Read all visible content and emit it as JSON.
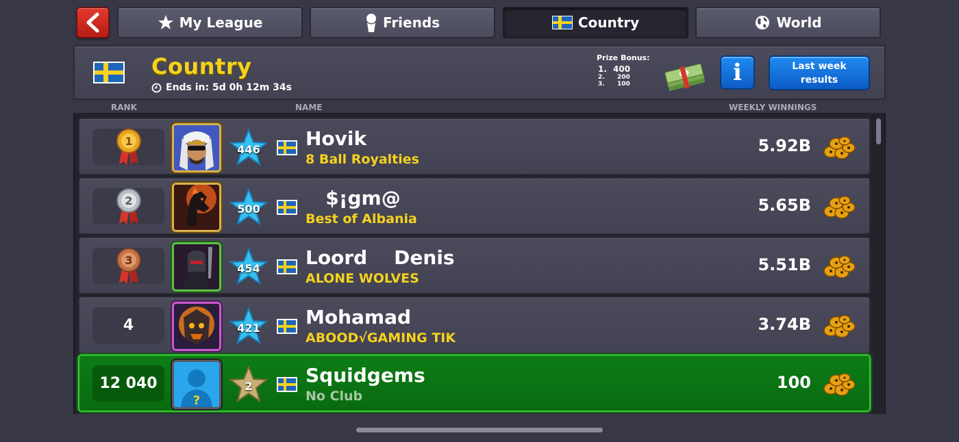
{
  "tabs": [
    {
      "label": "My League",
      "icon": "star-icon"
    },
    {
      "label": "Friends",
      "icon": "person-icon"
    },
    {
      "label": "Country",
      "icon": "sweden-flag-icon",
      "active": true
    },
    {
      "label": "World",
      "icon": "globe-icon"
    }
  ],
  "header": {
    "title": "Country",
    "ends_in": "Ends in: 5d 0h 12m 34s",
    "prize_label": "Prize Bonus:",
    "prizes": [
      {
        "rank": "1.",
        "value": "400"
      },
      {
        "rank": "2.",
        "value": "200"
      },
      {
        "rank": "3.",
        "value": "100"
      }
    ],
    "info_label": "i",
    "last_week_label": "Last week results"
  },
  "columns": {
    "rank": "RANK",
    "name": "NAME",
    "winnings": "WEEKLY WINNINGS"
  },
  "rows": [
    {
      "rank": "1",
      "rank_badge": "gold-medal-icon",
      "level": "446",
      "name": "Hovik",
      "club": "8 Ball Royalties",
      "winnings": "5.92B"
    },
    {
      "rank": "2",
      "rank_badge": "silver-medal-icon",
      "level": "500",
      "name": "   $¡gm@",
      "club": "Best of Albania",
      "winnings": "5.65B"
    },
    {
      "rank": "3",
      "rank_badge": "bronze-medal-icon",
      "level": "454",
      "name": "Loord    Denis",
      "club": "ALONE WOLVES",
      "winnings": "5.51B"
    },
    {
      "rank": "4",
      "level": "421",
      "name": "Mohamad",
      "club": "ABOOD√GAMING TIK",
      "winnings": "3.74B"
    },
    {
      "rank": "12 040",
      "level": "2",
      "name": "Squidgems",
      "club": "No Club",
      "winnings": "100",
      "is_me": true
    }
  ],
  "colors": {
    "accent_yellow": "#f6d21c",
    "button_blue": "#1f8bf0",
    "back_red": "#e23a2e",
    "my_row_green": "#0d7d16",
    "level_star_blue": "#35c0f0",
    "level_star_gold": "#c9b074"
  }
}
